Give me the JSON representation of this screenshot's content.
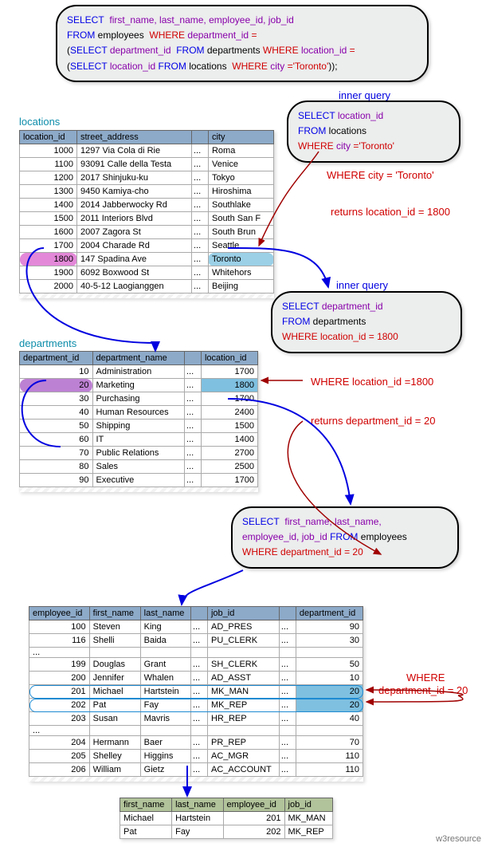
{
  "main_query": {
    "select": "SELECT",
    "cols": "first_name, last_name, employee_id, job_id",
    "from": "FROM",
    "tbl": "employees",
    "where": "WHERE",
    "wcol": "department_id",
    "eq": "=",
    "sub1_sel": "SELECT",
    "sub1_col": "department_id",
    "sub1_from": "FROM",
    "sub1_tbl": "departments",
    "sub1_where": "WHERE",
    "sub1_wcol": "location_id",
    "sub1_eq": "=",
    "sub2_sel": "SELECT",
    "sub2_col": "location_id",
    "sub2_from": "FROM",
    "sub2_tbl": "locations",
    "sub2_where": "WHERE",
    "sub2_wcol": "city",
    "sub2_val": "'Toronto'",
    "close": "));"
  },
  "labels": {
    "inner1": "inner query",
    "inner2": "inner query",
    "where_city": "WHERE city = 'Toronto'",
    "ret_loc": "returns location_id = 1800",
    "where_loc": "WHERE location_id =1800",
    "ret_dept": "returns department_id = 20",
    "where_dept": "WHERE",
    "where_dept2": "department_id = 20",
    "tbl_loc": "locations",
    "tbl_dept": "departments",
    "watermark": "w3resource"
  },
  "inner_q1": {
    "sel": "SELECT",
    "col": "location_id",
    "from": "FROM",
    "tbl": "locations",
    "where": "WHERE",
    "wcol": "city",
    "cond": "='Toronto'"
  },
  "inner_q2": {
    "sel": "SELECT",
    "col": "department_id",
    "from": "FROM",
    "tbl": "departments",
    "where": "WHERE",
    "cond": "location_id = 1800"
  },
  "final_q": {
    "sel": "SELECT",
    "cols": "first_name, last_name,",
    "cols2": "employee_id, job_id",
    "from": "FROM",
    "tbl": "employees",
    "where": "WHERE",
    "cond": "department_id = 20"
  },
  "locations": {
    "headers": [
      "location_id",
      "street_address",
      "",
      "city"
    ],
    "rows": [
      [
        "1000",
        "1297 Via Cola di Rie",
        "...",
        "Roma"
      ],
      [
        "1100",
        "93091 Calle della Testa",
        "...",
        "Venice"
      ],
      [
        "1200",
        "2017 Shinjuku-ku",
        "...",
        "Tokyo"
      ],
      [
        "1300",
        "9450 Kamiya-cho",
        "...",
        "Hiroshima"
      ],
      [
        "1400",
        "2014 Jabberwocky Rd",
        "...",
        "Southlake"
      ],
      [
        "1500",
        "2011 Interiors Blvd",
        "...",
        "South San F"
      ],
      [
        "1600",
        "2007 Zagora St",
        "...",
        "South Brun"
      ],
      [
        "1700",
        "2004 Charade Rd",
        "...",
        "Seattle"
      ],
      [
        "1800",
        "147 Spadina Ave",
        "...",
        "Toronto"
      ],
      [
        "1900",
        "6092 Boxwood St",
        "...",
        "Whitehors"
      ],
      [
        "2000",
        "40-5-12 Laogianggen",
        "...",
        "Beijing"
      ]
    ]
  },
  "departments": {
    "headers": [
      "department_id",
      "department_name",
      "",
      "location_id"
    ],
    "rows": [
      [
        "10",
        "Administration",
        "...",
        "1700"
      ],
      [
        "20",
        "Marketing",
        "...",
        "1800"
      ],
      [
        "30",
        "Purchasing",
        "...",
        "1700"
      ],
      [
        "40",
        "Human Resources",
        "...",
        "2400"
      ],
      [
        "50",
        "Shipping",
        "...",
        "1500"
      ],
      [
        "60",
        "IT",
        "...",
        "1400"
      ],
      [
        "70",
        "Public Relations",
        "...",
        "2700"
      ],
      [
        "80",
        "Sales",
        "...",
        "2500"
      ],
      [
        "90",
        "Executive",
        "...",
        "1700"
      ]
    ]
  },
  "employees": {
    "headers": [
      "employee_id",
      "first_name",
      "last_name",
      "",
      "job_id",
      "",
      "department_id"
    ],
    "rows": [
      [
        "100",
        "Steven",
        "King",
        "...",
        "AD_PRES",
        "...",
        "90"
      ],
      [
        "116",
        "Shelli",
        "Baida",
        "...",
        "PU_CLERK",
        "...",
        "30"
      ],
      [
        "...",
        "",
        "",
        "",
        "",
        "",
        ""
      ],
      [
        "199",
        "Douglas",
        "Grant",
        "...",
        "SH_CLERK",
        "...",
        "50"
      ],
      [
        "200",
        "Jennifer",
        "Whalen",
        "...",
        "AD_ASST",
        "...",
        "10"
      ],
      [
        "201",
        "Michael",
        "Hartstein",
        "...",
        "MK_MAN",
        "...",
        "20"
      ],
      [
        "202",
        "Pat",
        "Fay",
        "...",
        "MK_REP",
        "...",
        "20"
      ],
      [
        "203",
        "Susan",
        "Mavris",
        "...",
        "HR_REP",
        "...",
        "40"
      ],
      [
        "...",
        "",
        "",
        "",
        "",
        "",
        ""
      ],
      [
        "204",
        "Hermann",
        "Baer",
        "...",
        "PR_REP",
        "...",
        "70"
      ],
      [
        "205",
        "Shelley",
        "Higgins",
        "...",
        "AC_MGR",
        "...",
        "110"
      ],
      [
        "206",
        "William",
        "Gietz",
        "...",
        "AC_ACCOUNT",
        "...",
        "110"
      ]
    ]
  },
  "result": {
    "headers": [
      "first_name",
      "last_name",
      "employee_id",
      "job_id"
    ],
    "rows": [
      [
        "Michael",
        "Hartstein",
        "201",
        "MK_MAN"
      ],
      [
        "Pat",
        "Fay",
        "202",
        "MK_REP"
      ]
    ]
  }
}
